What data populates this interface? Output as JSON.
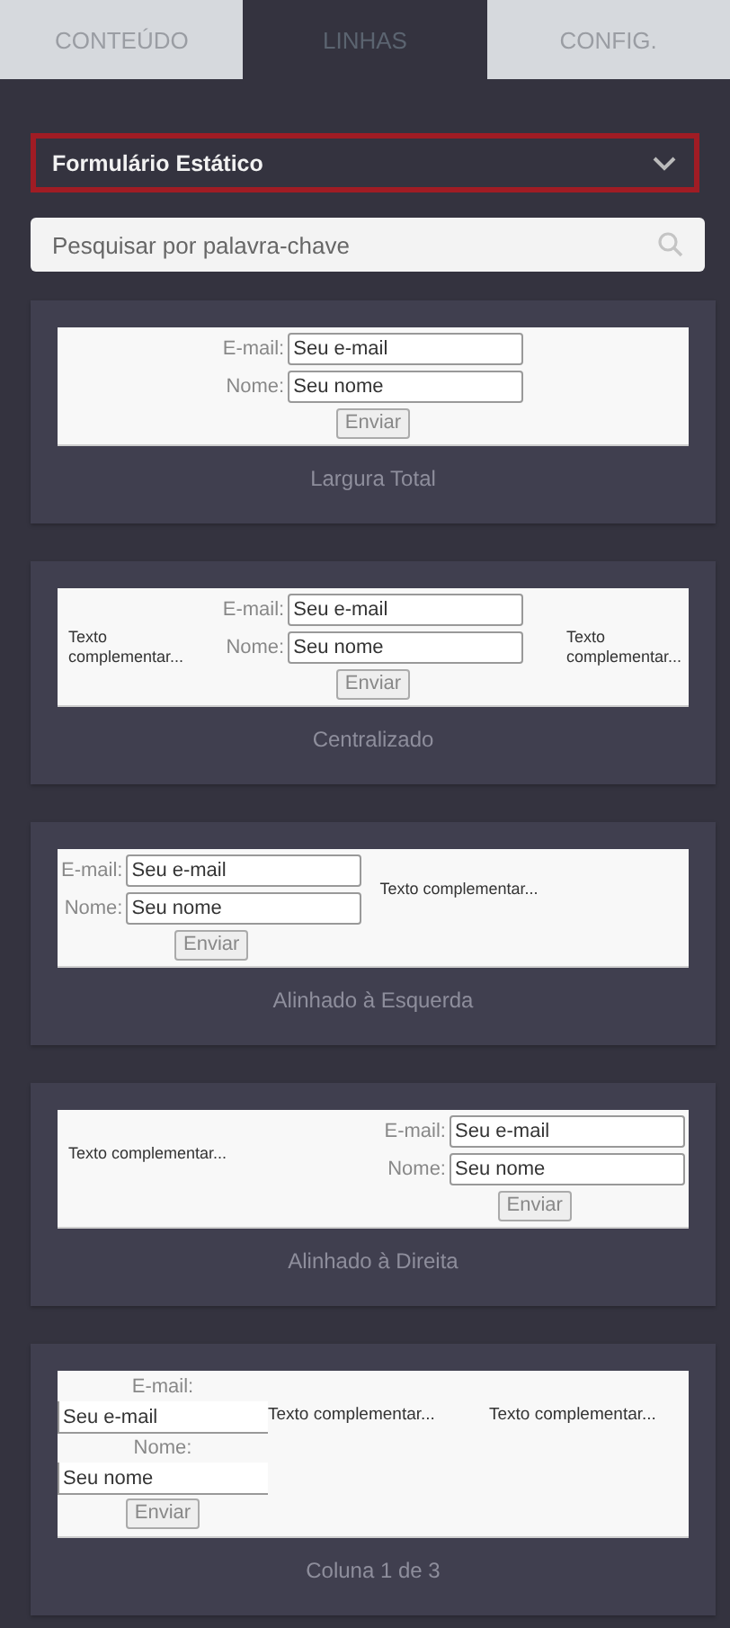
{
  "tabs": [
    {
      "label": "CONTEÚDO",
      "selected": false
    },
    {
      "label": "LINHAS",
      "selected": true
    },
    {
      "label": "CONFIG.",
      "selected": false
    }
  ],
  "dropdown": {
    "value": "Formulário Estático"
  },
  "search": {
    "placeholder": "Pesquisar por palavra-chave"
  },
  "templates": [
    {
      "kind": "full",
      "caption": "Largura Total",
      "form": {
        "email_label": "E-mail:",
        "email_placeholder": "Seu e-mail",
        "name_label": "Nome:",
        "name_placeholder": "Seu nome",
        "button": "Enviar"
      }
    },
    {
      "kind": "center",
      "caption": "Centralizado",
      "form": {
        "email_label": "E-mail:",
        "email_placeholder": "Seu e-mail",
        "name_label": "Nome:",
        "name_placeholder": "Seu nome",
        "button": "Enviar"
      },
      "side_texts": [
        "Texto complementar...",
        "Texto complementar..."
      ]
    },
    {
      "kind": "left",
      "caption": "Alinhado à Esquerda",
      "form": {
        "email_label": "E-mail:",
        "email_placeholder": "Seu e-mail",
        "name_label": "Nome:",
        "name_placeholder": "Seu nome",
        "button": "Enviar"
      },
      "side_texts": [
        "Texto complementar..."
      ]
    },
    {
      "kind": "right",
      "caption": "Alinhado à Direita",
      "form": {
        "email_label": "E-mail:",
        "email_placeholder": "Seu e-mail",
        "name_label": "Nome:",
        "name_placeholder": "Seu nome",
        "button": "Enviar"
      },
      "side_texts": [
        "Texto complementar..."
      ]
    },
    {
      "kind": "columns",
      "caption": "Coluna 1 de 3",
      "form": {
        "email_label": "E-mail:",
        "email_placeholder": "Seu e-mail",
        "name_label": "Nome:",
        "name_placeholder": "Seu nome",
        "button": "Enviar"
      },
      "side_texts": [
        "Texto complementar...",
        "Texto complementar..."
      ]
    }
  ]
}
